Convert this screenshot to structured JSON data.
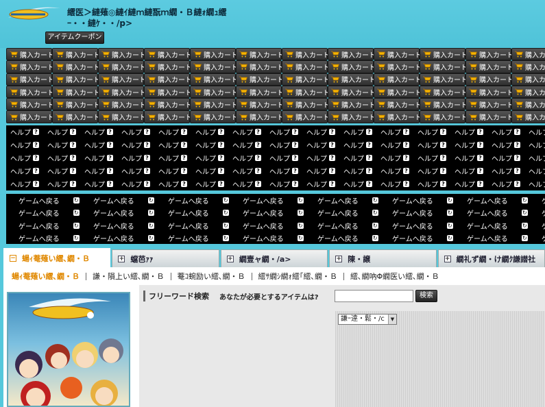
{
  "header": {
    "title": "繧医＞縺薙◎縺ｲ縺ｍ縺翫ｍ繝・Ｂ縺ｫ繝ｭ繧ｰ・・縺ｹ・・/p>",
    "coupon_label": "アイテムクーポン"
  },
  "cart": {
    "label": "購入カート",
    "count": 72
  },
  "help": {
    "label": "ヘルプ",
    "icon": "?",
    "count": 75
  },
  "game_return": {
    "label": "ゲームへ戻る",
    "icon": "↻",
    "count": 32
  },
  "tabs": [
    {
      "label": "蝪ｨ菴薙い繧､繝・Ｂ",
      "icon": "−",
      "active": true
    },
    {
      "label": "蟷芭ｧｧ",
      "icon": "+",
      "active": false
    },
    {
      "label": "繝壹ャ繝・/a>",
      "icon": "+",
      "active": false
    },
    {
      "label": "陳・譲",
      "icon": "+",
      "active": false
    },
    {
      "label": "繝礼ず繝・け繝ｸ謙譛社",
      "icon": "+",
      "active": false
    }
  ],
  "subnav": [
    {
      "label": "蝪ｨ菴薙い繧､繝・Ｂ",
      "active": true
    },
    {
      "label": "謙・隕上い繧､繝・Ｂ",
      "active": false
    },
    {
      "label": "菴ｺ蜿励い繧､繝・Ｂ",
      "active": false
    },
    {
      "label": "繧ｻ繝ｼ繝ｫ繧｢繧､繝・Ｂ",
      "active": false
    },
    {
      "label": "繧､繝吶Φ繝医い繧､繝・Ｂ",
      "active": false
    }
  ],
  "search": {
    "title": "フリーワード検索",
    "question": "あなたが必要とするアイテムは?",
    "input_value": "",
    "button_label": "検索",
    "category_value": "謙ｰ逹・鬆・/c"
  },
  "colors": {
    "accent": "#e08800",
    "background": "#55c8dc",
    "band": "#000000",
    "button": "#3a3a3a"
  }
}
